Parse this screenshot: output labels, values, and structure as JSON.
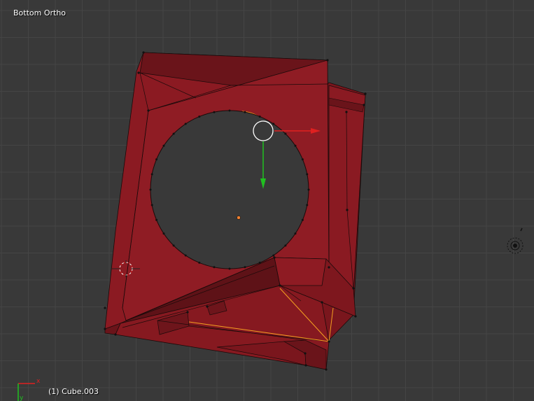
{
  "viewport": {
    "view_name": "Bottom Ortho",
    "object_label": "(1) Cube.003",
    "background_color": "#393939",
    "grid_color": "#454545"
  },
  "mesh": {
    "face_color": "#8b1a22",
    "shadow_face_color": "#6a141a",
    "selected_edge_color": "#f4a020",
    "edge_color": "#1a0a0a"
  },
  "gizmo": {
    "x_axis_color": "#e02020",
    "y_axis_color": "#20c020",
    "center_ring_color": "#ffffff"
  },
  "axis_widget": {
    "x_label": "x",
    "y_label": "y"
  }
}
